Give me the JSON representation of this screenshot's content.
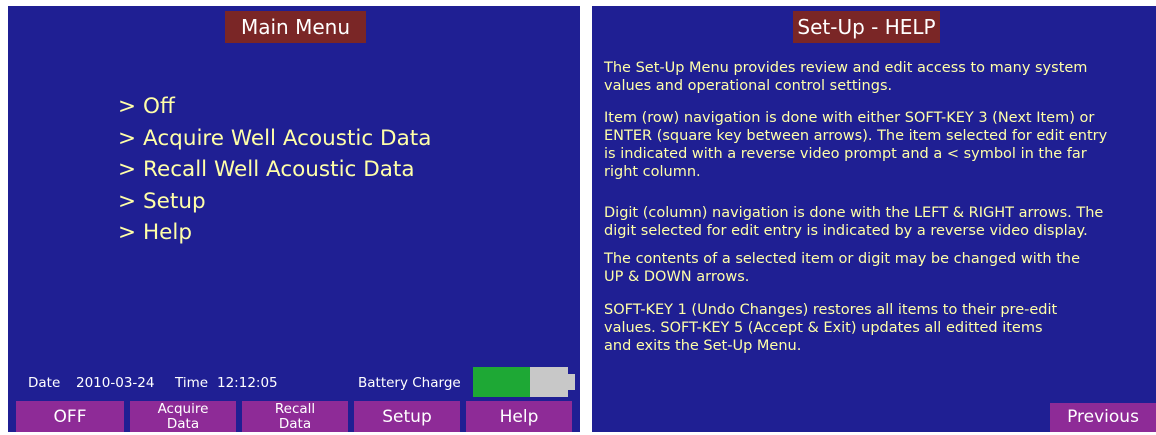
{
  "main_menu": {
    "title": "Main Menu",
    "items": [
      {
        "caret": ">",
        "label": "Off"
      },
      {
        "caret": ">",
        "label": "Acquire Well Acoustic Data"
      },
      {
        "caret": ">",
        "label": "Recall Well Acoustic Data"
      },
      {
        "caret": ">",
        "label": "Setup"
      },
      {
        "caret": ">",
        "label": "Help"
      }
    ],
    "status": {
      "date_label": "Date",
      "date": "2010-03-24",
      "time_label": "Time",
      "time": "12:12:05",
      "battery_label": "Battery Charge",
      "battery_level": 0.56
    },
    "softkeys": [
      {
        "line1": "OFF",
        "line2": ""
      },
      {
        "line1": "Acquire",
        "line2": "Data"
      },
      {
        "line1": "Recall",
        "line2": "Data"
      },
      {
        "line1": "Setup",
        "line2": ""
      },
      {
        "line1": "Help",
        "line2": ""
      }
    ]
  },
  "help": {
    "title": "Set-Up - HELP",
    "paragraphs": [
      "The Set-Up Menu provides review and edit access to many system\nvalues and operational control settings.",
      "Item (row) navigation is done with either SOFT-KEY 3 (Next Item) or\nENTER (square key between arrows).  The item selected for edit entry\n is indicated with a reverse video prompt and a < symbol in the far\n right column.",
      "Digit (column) navigation is done with the LEFT & RIGHT arrows.  The\ndigit selected for edit entry is indicated by a reverse video display.",
      "The contents of a selected item or digit may be changed with the\nUP & DOWN arrows.",
      "SOFT-KEY 1 (Undo Changes) restores all items to their pre-edit\nvalues.  SOFT-KEY 5 (Accept & Exit) updates all editted items\nand exits the Set-Up Menu."
    ],
    "previous_label": "Previous"
  },
  "colors": {
    "screen_bg": "#1f1f93",
    "title_bg": "#7a2626",
    "menu_text": "#ffffa8",
    "softkey_bg": "#8e2b97",
    "battery_fill": "#1ea835",
    "battery_empty": "#c8c8c8"
  }
}
